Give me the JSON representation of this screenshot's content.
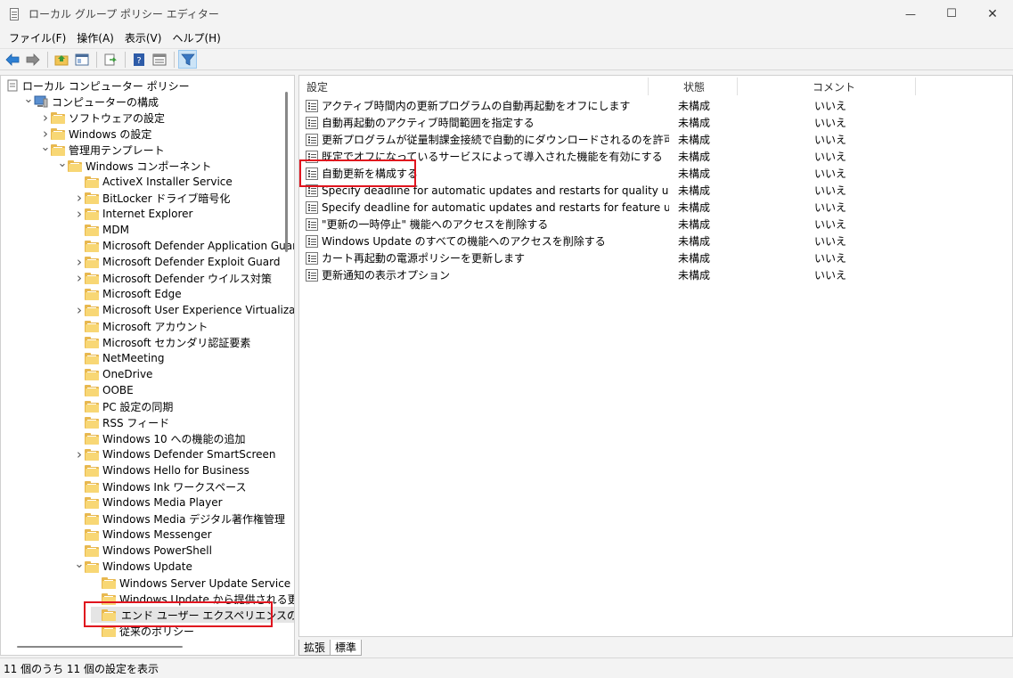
{
  "window": {
    "title": "ローカル グループ ポリシー エディター",
    "minimize": "—",
    "maximize": "☐",
    "close": "✕"
  },
  "menu": [
    "ファイル(F)",
    "操作(A)",
    "表示(V)",
    "ヘルプ(H)"
  ],
  "toolbar": [
    "back-arrow-icon",
    "forward-arrow-icon",
    "up-folder-icon",
    "show-hide-tree-icon",
    "export-list-icon",
    "help-icon",
    "properties-icon",
    "filter-icon"
  ],
  "tree": [
    {
      "label": "ローカル コンピューター ポリシー",
      "level": 0,
      "chevron": "",
      "icon": "policy"
    },
    {
      "label": "コンピューターの構成",
      "level": 1,
      "chevron": "v",
      "icon": "computer"
    },
    {
      "label": "ソフトウェアの設定",
      "level": 2,
      "chevron": ">",
      "icon": "folder"
    },
    {
      "label": "Windows の設定",
      "level": 2,
      "chevron": ">",
      "icon": "folder"
    },
    {
      "label": "管理用テンプレート",
      "level": 2,
      "chevron": "v",
      "icon": "folder"
    },
    {
      "label": "Windows コンポーネント",
      "level": 3,
      "chevron": "v",
      "icon": "folder"
    },
    {
      "label": "ActiveX Installer Service",
      "level": 4,
      "chevron": "",
      "icon": "folder"
    },
    {
      "label": "BitLocker ドライブ暗号化",
      "level": 4,
      "chevron": ">",
      "icon": "folder"
    },
    {
      "label": "Internet Explorer",
      "level": 4,
      "chevron": ">",
      "icon": "folder"
    },
    {
      "label": "MDM",
      "level": 4,
      "chevron": "",
      "icon": "folder"
    },
    {
      "label": "Microsoft Defender Application Guard",
      "level": 4,
      "chevron": "",
      "icon": "folder"
    },
    {
      "label": "Microsoft Defender Exploit Guard",
      "level": 4,
      "chevron": ">",
      "icon": "folder"
    },
    {
      "label": "Microsoft Defender ウイルス対策",
      "level": 4,
      "chevron": ">",
      "icon": "folder"
    },
    {
      "label": "Microsoft Edge",
      "level": 4,
      "chevron": "",
      "icon": "folder"
    },
    {
      "label": "Microsoft User Experience Virtualization",
      "level": 4,
      "chevron": ">",
      "icon": "folder"
    },
    {
      "label": "Microsoft アカウント",
      "level": 4,
      "chevron": "",
      "icon": "folder"
    },
    {
      "label": "Microsoft セカンダリ認証要素",
      "level": 4,
      "chevron": "",
      "icon": "folder"
    },
    {
      "label": "NetMeeting",
      "level": 4,
      "chevron": "",
      "icon": "folder"
    },
    {
      "label": "OneDrive",
      "level": 4,
      "chevron": "",
      "icon": "folder"
    },
    {
      "label": "OOBE",
      "level": 4,
      "chevron": "",
      "icon": "folder"
    },
    {
      "label": "PC 設定の同期",
      "level": 4,
      "chevron": "",
      "icon": "folder"
    },
    {
      "label": "RSS フィード",
      "level": 4,
      "chevron": "",
      "icon": "folder"
    },
    {
      "label": "Windows 10 への機能の追加",
      "level": 4,
      "chevron": "",
      "icon": "folder"
    },
    {
      "label": "Windows Defender SmartScreen",
      "level": 4,
      "chevron": ">",
      "icon": "folder"
    },
    {
      "label": "Windows Hello for Business",
      "level": 4,
      "chevron": "",
      "icon": "folder"
    },
    {
      "label": "Windows Ink ワークスペース",
      "level": 4,
      "chevron": "",
      "icon": "folder"
    },
    {
      "label": "Windows Media Player",
      "level": 4,
      "chevron": "",
      "icon": "folder"
    },
    {
      "label": "Windows Media デジタル著作権管理",
      "level": 4,
      "chevron": "",
      "icon": "folder"
    },
    {
      "label": "Windows Messenger",
      "level": 4,
      "chevron": "",
      "icon": "folder"
    },
    {
      "label": "Windows PowerShell",
      "level": 4,
      "chevron": "",
      "icon": "folder"
    },
    {
      "label": "Windows Update",
      "level": 4,
      "chevron": "v",
      "icon": "folder"
    },
    {
      "label": "Windows Server Update Service から提",
      "level": 5,
      "chevron": "",
      "icon": "folder"
    },
    {
      "label": "Windows Update から提供される更新プ",
      "level": 5,
      "chevron": "",
      "icon": "folder"
    },
    {
      "label": "エンド ユーザー エクスペリエンスの管理",
      "level": 5,
      "chevron": "",
      "icon": "folder",
      "selected": true
    },
    {
      "label": "従来のポリシー",
      "level": 5,
      "chevron": "",
      "icon": "folder"
    }
  ],
  "list": {
    "headers": {
      "name": "設定",
      "state": "状態",
      "comment": "コメント"
    },
    "rows": [
      {
        "name": "アクティブ時間内の更新プログラムの自動再起動をオフにします",
        "state": "未構成",
        "comment": "いいえ"
      },
      {
        "name": "自動再起動のアクティブ時間範囲を指定する",
        "state": "未構成",
        "comment": "いいえ"
      },
      {
        "name": "更新プログラムが従量制課金接続で自動的にダウンロードされるのを許可する",
        "state": "未構成",
        "comment": "いいえ"
      },
      {
        "name": "既定でオフになっているサービスによって導入された機能を有効にする",
        "state": "未構成",
        "comment": "いいえ"
      },
      {
        "name": "自動更新を構成する",
        "state": "未構成",
        "comment": "いいえ"
      },
      {
        "name": "Specify deadline for automatic updates and restarts for quality update",
        "state": "未構成",
        "comment": "いいえ"
      },
      {
        "name": "Specify deadline for automatic updates and restarts for feature update",
        "state": "未構成",
        "comment": "いいえ"
      },
      {
        "name": "\"更新の一時停止\" 機能へのアクセスを削除する",
        "state": "未構成",
        "comment": "いいえ"
      },
      {
        "name": "Windows Update のすべての機能へのアクセスを削除する",
        "state": "未構成",
        "comment": "いいえ"
      },
      {
        "name": "カート再起動の電源ポリシーを更新します",
        "state": "未構成",
        "comment": "いいえ"
      },
      {
        "name": "更新通知の表示オプション",
        "state": "未構成",
        "comment": "いいえ"
      }
    ]
  },
  "tabs": [
    "拡張",
    "標準"
  ],
  "status": "11 個のうち 11 個の設定を表示",
  "colors": {
    "highlight": "#e0141e",
    "folder": "#f8d775",
    "selection": "#e5e5e5"
  }
}
